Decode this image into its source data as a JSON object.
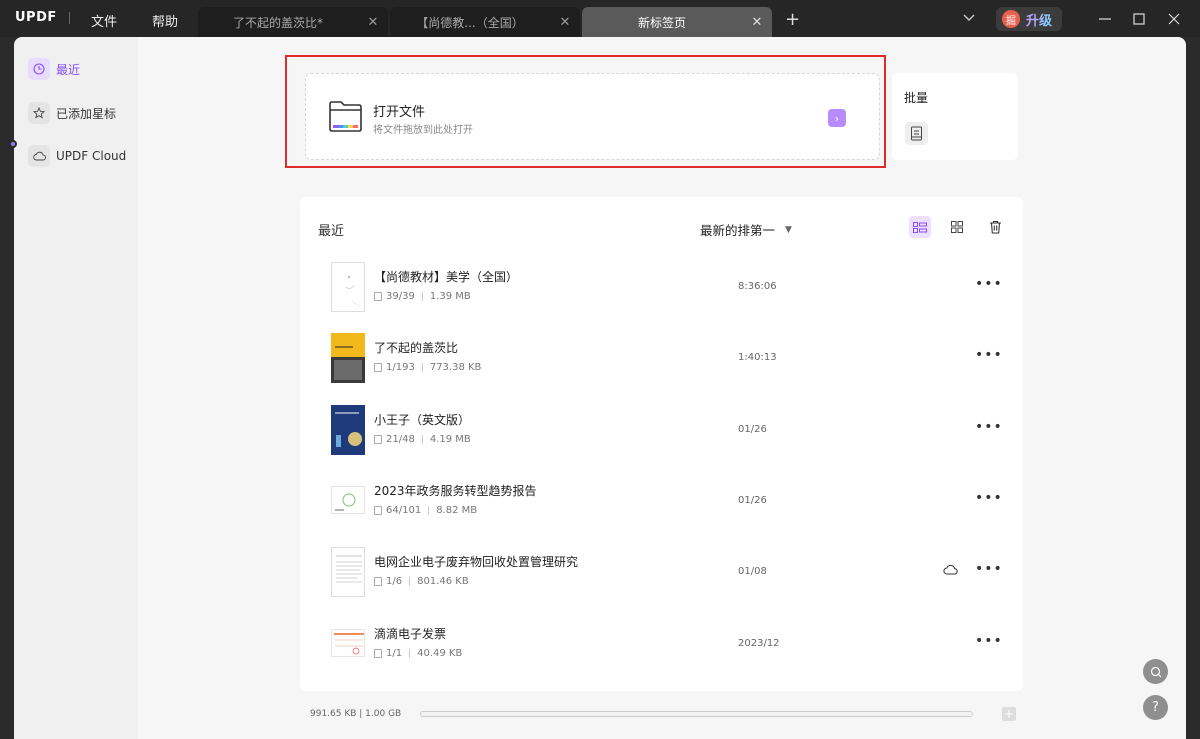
{
  "titlebar": {
    "logo": "UPDF",
    "menu_file": "文件",
    "menu_help": "帮助",
    "tabs": [
      {
        "label": "了不起的盖茨比*",
        "close": "✕"
      },
      {
        "label": "【尚德教...（全国）",
        "close": "✕"
      },
      {
        "label": "新标签页",
        "close": "✕"
      }
    ],
    "new_tab": "+",
    "upgrade_avatar": "掘",
    "upgrade_label": "升级"
  },
  "sidebar": {
    "items": [
      {
        "label": "最近",
        "icon": "clock-icon",
        "active": true
      },
      {
        "label": "已添加星标",
        "icon": "star-icon"
      },
      {
        "label": "UPDF Cloud",
        "icon": "cloud-icon"
      }
    ]
  },
  "open_file": {
    "title": "打开文件",
    "subtitle": "将文件拖放到此处打开",
    "arrow": "›"
  },
  "batch": {
    "title": "批量"
  },
  "recent": {
    "title": "最近",
    "sort_label": "最新的排第一",
    "files": [
      {
        "name": "【尚德教材】美学（全国）",
        "pages": "39/39",
        "size": "1.39 MB",
        "date": "8:36:06",
        "cloud": false
      },
      {
        "name": "了不起的盖茨比",
        "pages": "1/193",
        "size": "773.38 KB",
        "date": "1:40:13",
        "cloud": false
      },
      {
        "name": "小王子（英文版）",
        "pages": "21/48",
        "size": "4.19 MB",
        "date": "01/26",
        "cloud": false
      },
      {
        "name": "2023年政务服务转型趋势报告",
        "pages": "64/101",
        "size": "8.82 MB",
        "date": "01/26",
        "cloud": false
      },
      {
        "name": "电网企业电子废弃物回收处置管理研究",
        "pages": "1/6",
        "size": "801.46 KB",
        "date": "01/08",
        "cloud": true
      },
      {
        "name": "滴滴电子发票",
        "pages": "1/1",
        "size": "40.49 KB",
        "date": "2023/12",
        "cloud": false
      }
    ]
  },
  "footer": {
    "storage": "991.65 KB | 1.00 GB"
  },
  "colors": {
    "accent": "#8a4dff",
    "highlight": "#e02b2b"
  }
}
